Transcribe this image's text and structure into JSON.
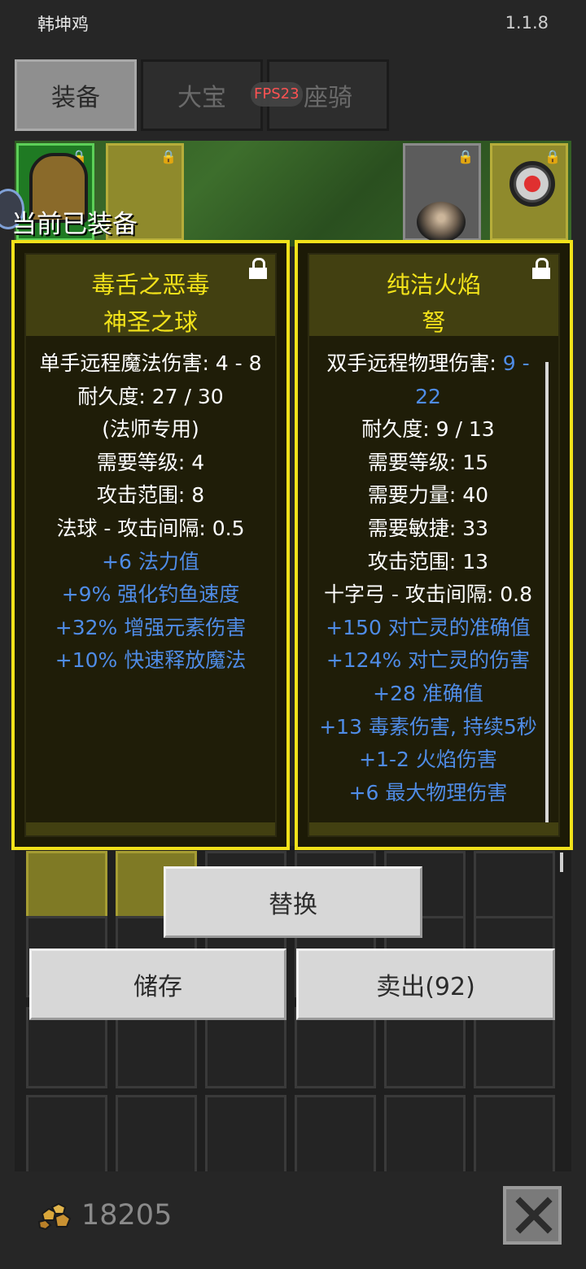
{
  "status_bar": {
    "app_title": "韩坤鸡",
    "version": "1.1.8"
  },
  "tabs": [
    {
      "label": "装备",
      "active": true
    },
    {
      "label": "大宝",
      "active": false
    },
    {
      "label": "座骑",
      "active": false
    }
  ],
  "fps_badge": "FPS23",
  "equipped_label": "当前已装备",
  "cards": {
    "equipped": {
      "name_line1": "毒舌之恶毒",
      "name_line2": "神圣之球",
      "locked": true,
      "stats": [
        "单手远程魔法伤害: 4 - 8",
        "耐久度: 27 / 30",
        "(法师专用)",
        "需要等级: 4",
        "攻击范围: 8",
        "法球 - 攻击间隔: 0.5"
      ],
      "bonuses": [
        "+6 法力值",
        "+9% 强化钓鱼速度",
        "+32% 增强元素伤害",
        "+10% 快速释放魔法"
      ]
    },
    "new_item": {
      "name_line1": "纯洁火焰",
      "name_line2": "弩",
      "locked": true,
      "damage_label": "双手远程物理伤害: ",
      "damage_value_part1": "9 -",
      "damage_value_part2": "22",
      "stats": [
        "耐久度: 9 / 13",
        "需要等级: 15",
        "需要力量: 40",
        "需要敏捷: 33",
        "攻击范围: 13",
        "十字弓 - 攻击间隔: 0.8"
      ],
      "bonuses": [
        "+150 对亡灵的准确值",
        "+124% 对亡灵的伤害",
        "+28 准确值",
        "+13 毒素伤害, 持续5秒",
        "+1-2 火焰伤害",
        "+6 最大物理伤害"
      ]
    }
  },
  "buttons": {
    "replace": "替换",
    "store": "储存",
    "sell": "卖出(92)"
  },
  "footer": {
    "gold_icon": "gold-nuggets-icon",
    "gold_amount": "18205",
    "close_icon": "close-icon"
  },
  "colors": {
    "card_border": "#f2e21a",
    "item_name": "#f2e21a",
    "bonus_text": "#4f8ce6",
    "fps": "#ff5252"
  }
}
